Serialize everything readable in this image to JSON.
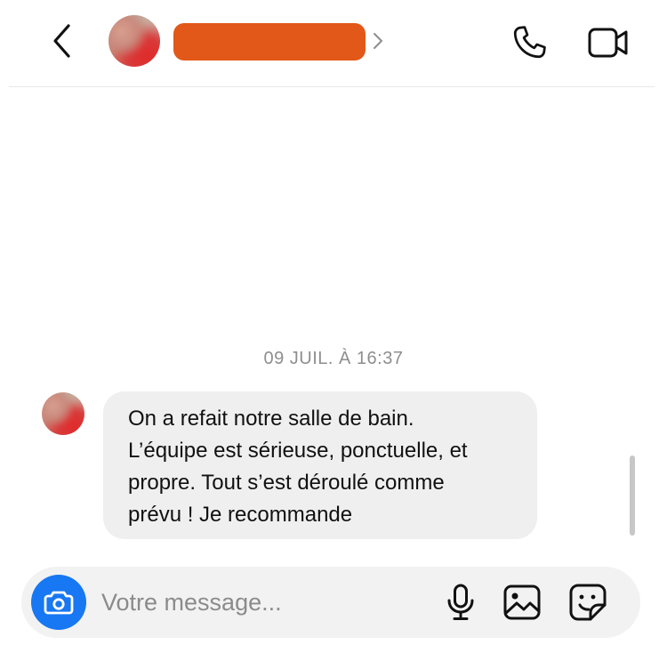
{
  "header": {
    "back_icon": "chevron-left-icon",
    "contact_name_redacted_color": "#e25818",
    "profile_chevron_icon": "chevron-right-icon",
    "call_icon": "phone-icon",
    "video_icon": "video-camera-icon"
  },
  "conversation": {
    "timestamp": "09 JUIL. À 16:37",
    "messages": [
      {
        "sender": "contact",
        "lines": [
          "On a refait notre salle de bain.",
          "L’équipe est sérieuse, ponctuelle, et",
          "propre. Tout s’est déroulé comme",
          "prévu ! Je recommande"
        ]
      }
    ]
  },
  "composer": {
    "placeholder": "Votre message...",
    "camera_icon": "camera-icon",
    "mic_icon": "microphone-icon",
    "gallery_icon": "image-icon",
    "sticker_icon": "sticker-icon",
    "accent_color": "#1877f2"
  }
}
